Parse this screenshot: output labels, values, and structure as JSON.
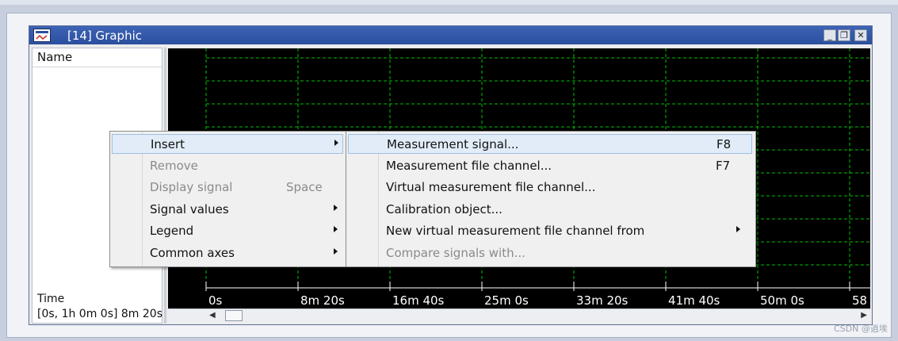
{
  "window": {
    "title": "[14] Graphic",
    "controls": {
      "minimize": "_",
      "restore": "❐",
      "close": "✕"
    }
  },
  "name_pane": {
    "header": "Name",
    "time_label": "Time",
    "time_range": "[0s, 1h 0m 0s] 8m 20s"
  },
  "plot": {
    "background": "#000000",
    "grid_color": "#00c000",
    "axis_ticks": [
      "0s",
      "8m 20s",
      "16m 40s",
      "25m 0s",
      "33m 20s",
      "41m 40s",
      "50m 0s",
      "58"
    ]
  },
  "context_menu": {
    "items": [
      {
        "label": "Insert",
        "shortcut": "",
        "submenu": true,
        "disabled": false,
        "highlighted": true
      },
      {
        "label": "Remove",
        "shortcut": "",
        "submenu": false,
        "disabled": true,
        "highlighted": false
      },
      {
        "label": "Display signal",
        "shortcut": "Space",
        "submenu": false,
        "disabled": true,
        "highlighted": false
      },
      {
        "label": "Signal values",
        "shortcut": "",
        "submenu": true,
        "disabled": false,
        "highlighted": false
      },
      {
        "label": "Legend",
        "shortcut": "",
        "submenu": true,
        "disabled": false,
        "highlighted": false
      },
      {
        "label": "Common axes",
        "shortcut": "",
        "submenu": true,
        "disabled": false,
        "highlighted": false
      }
    ]
  },
  "insert_submenu": {
    "items": [
      {
        "label": "Measurement signal...",
        "shortcut": "F8",
        "submenu": false,
        "disabled": false,
        "highlighted": true
      },
      {
        "label": "Measurement file channel...",
        "shortcut": "F7",
        "submenu": false,
        "disabled": false,
        "highlighted": false
      },
      {
        "label": "Virtual measurement file channel...",
        "shortcut": "",
        "submenu": false,
        "disabled": false,
        "highlighted": false
      },
      {
        "label": "Calibration object...",
        "shortcut": "",
        "submenu": false,
        "disabled": false,
        "highlighted": false
      },
      {
        "label": "New virtual measurement file channel from",
        "shortcut": "",
        "submenu": true,
        "disabled": false,
        "highlighted": false
      },
      {
        "label": "Compare signals with...",
        "shortcut": "",
        "submenu": false,
        "disabled": true,
        "highlighted": false
      }
    ]
  },
  "watermark": "CSDN @逍埃"
}
